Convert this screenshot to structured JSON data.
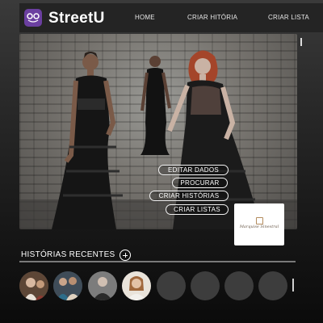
{
  "app": {
    "brand": "StreetU",
    "brand_color": "#6b3fa0"
  },
  "nav": {
    "home": "HOME",
    "create_story": "CRIAR HITÓRIA",
    "create_list": "CRIAR LISTA"
  },
  "hero": {
    "image": "fashion-editorial-photo",
    "actions": {
      "edit": "EDITAR DADOS",
      "search": "PROCURAR",
      "create_stories": "CRIAR HISTÓRIAS",
      "create_lists": "CRIAR LISTAS"
    }
  },
  "sponsor": {
    "name": "Marquise Sinestral",
    "accent": "#b38b5d"
  },
  "recent": {
    "title": "HISTÓRIAS RECENTES",
    "add_icon": "plus-circle-icon",
    "stories": [
      {
        "type": "photo",
        "tone": "#7a5a44"
      },
      {
        "type": "photo",
        "tone": "#4a5a6a"
      },
      {
        "type": "photo",
        "tone": "#6a6a6a"
      },
      {
        "type": "photo",
        "tone": "#a08060"
      },
      {
        "type": "empty"
      },
      {
        "type": "empty"
      },
      {
        "type": "empty"
      },
      {
        "type": "empty"
      }
    ]
  }
}
